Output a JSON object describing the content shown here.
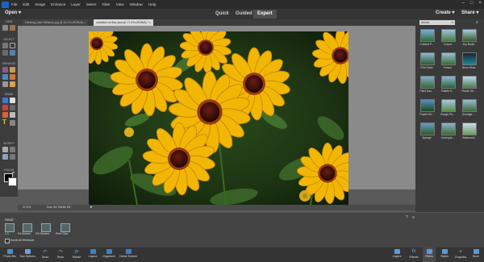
{
  "menubar": {
    "items": [
      "File",
      "Edit",
      "Image",
      "Enhance",
      "Layer",
      "Select",
      "Filter",
      "View",
      "Window",
      "Help"
    ]
  },
  "topbar": {
    "open": "Open",
    "modes": [
      "Quick",
      "Guided",
      "Expert"
    ],
    "active_mode": "Expert",
    "create": "Create",
    "share": "Share"
  },
  "tabs": [
    "Harlung Lake Hibiscus.jpg @ 15.2% (RGB/8)",
    "variation on lilac.psd @ 17.2% (RGB/8) *"
  ],
  "toolbox": {
    "view": "VIEW",
    "select": "SELECT",
    "enhance": "ENHANCE",
    "draw": "DRAW",
    "modify": "MODIFY",
    "color": "COLOR"
  },
  "statusbar": {
    "zoom": "17.2%",
    "doc": "Doc: 64.7M/48.7M"
  },
  "filters": {
    "selected": "Artistic",
    "items": [
      "Colored P...",
      "Cutout",
      "Dry Brush",
      "Film Grain",
      "Fresco",
      "Neon Glow",
      "Paint Dau...",
      "Palette K...",
      "Plastic Wr...",
      "Poster Ed...",
      "Rough Pa...",
      "Smudge ...",
      "Sponge",
      "Underpai...",
      "Watercolor"
    ]
  },
  "tool_options": {
    "tool_name": "Hand",
    "zoom_1to1": "1:1",
    "fit_screen": "Fit Screen",
    "fill_screen": "Fill Screen",
    "print_size": "Print Size",
    "scroll_all": "Scroll All Windows"
  },
  "bottombar": {
    "left": [
      "Photo Bin",
      "Tool Options",
      "Undo",
      "Redo",
      "Rotate",
      "Layout",
      "Organizer",
      "Home Screen"
    ],
    "right": [
      "Layers",
      "Effects",
      "Filters",
      "Styles",
      "Graphics",
      "More"
    ]
  },
  "colors": {
    "accent": "#1e62c7",
    "panel_dark": "#3a3a3a",
    "petal": "#f2b705",
    "leaf": "#2f4f24"
  }
}
